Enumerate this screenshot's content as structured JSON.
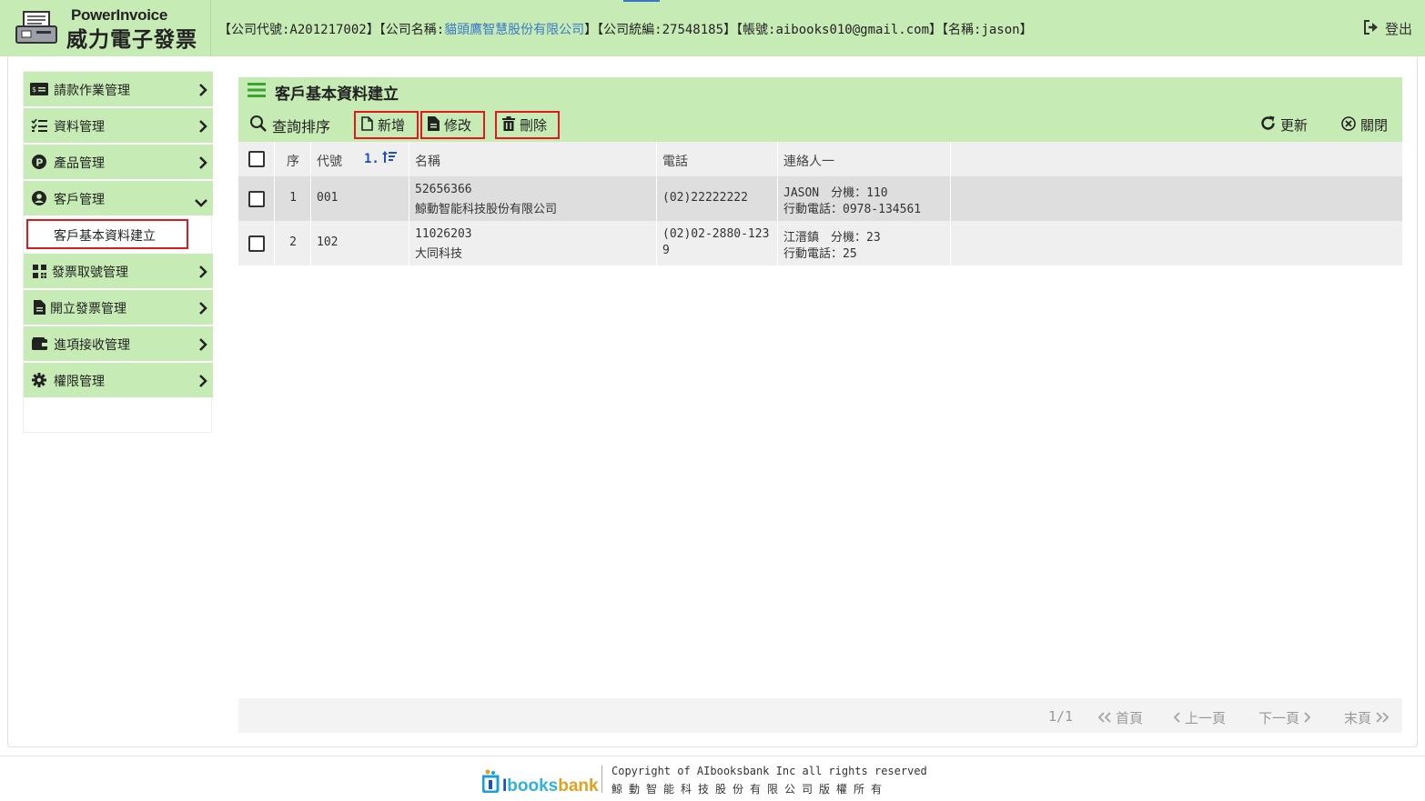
{
  "header": {
    "logo_en": "PowerInvoice",
    "logo_zh": "威力電子發票",
    "info_prefix": "【公司代號:A201217002】【公司名稱:",
    "company_name": "貓頭鷹智慧股份有限公司",
    "info_suffix": "】【公司統編:27548185】【帳號:aibooks010@gmail.com】【名稱:jason】",
    "logout_label": "登出"
  },
  "sidebar": {
    "items": [
      {
        "label": "請款作業管理",
        "icon": "money-card-icon"
      },
      {
        "label": "資料管理",
        "icon": "checklist-icon"
      },
      {
        "label": "產品管理",
        "icon": "product-p-icon"
      },
      {
        "label": "客戶管理",
        "icon": "user-circle-icon"
      },
      {
        "label": "發票取號管理",
        "icon": "qrcode-icon"
      },
      {
        "label": "開立發票管理",
        "icon": "document-icon"
      },
      {
        "label": "進項接收管理",
        "icon": "wallet-icon"
      },
      {
        "label": "權限管理",
        "icon": "gear-icon"
      }
    ],
    "sub_item": "客戶基本資料建立"
  },
  "page": {
    "title": "客戶基本資料建立"
  },
  "toolbar": {
    "search": "查詢排序",
    "add": "新增",
    "edit": "修改",
    "delete": "刪除",
    "refresh": "更新",
    "close": "關閉"
  },
  "table": {
    "headers": {
      "seq": "序",
      "code": "代號",
      "sort": "1.",
      "name": "名稱",
      "tel": "電話",
      "contact": "連絡人一"
    },
    "rows": [
      {
        "seq": "1",
        "code": "001",
        "tax_id": "52656366",
        "name": "鯨動智能科技股份有限公司",
        "tel": "(02)22222222",
        "contact": "JASON　分機：110",
        "mobile": "行動電話：0978-134561"
      },
      {
        "seq": "2",
        "code": "102",
        "tax_id": "11026203",
        "name": "大同科技",
        "tel_line1": "(02)02-2880-123",
        "tel_line2": "9",
        "contact": "江溍鎮　分機：23",
        "mobile": "行動電話：25"
      }
    ]
  },
  "pagination": {
    "count": "1/1",
    "first": "首頁",
    "prev": "上一頁",
    "next": "下一頁",
    "last": "末頁"
  },
  "footer": {
    "logo_i": "I",
    "logo_books": "books",
    "logo_bank": "bank",
    "copyright": "Copyright of AIbooksbank Inc all rights reserved",
    "copyright_zh": "鯨動智能科技股份有限公司版權所有"
  },
  "colors": {
    "accent_green": "#c6ebb4",
    "highlight_red": "#e0191f",
    "link_blue": "#3b79c8",
    "sort_blue": "#1a4fd0"
  }
}
